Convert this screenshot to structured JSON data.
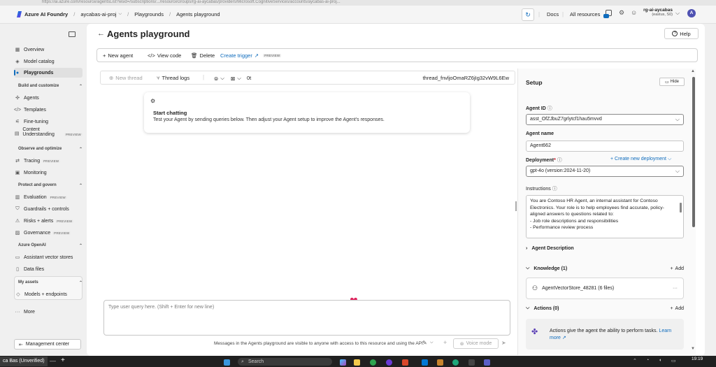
{
  "browser": {
    "url": "https://ai.azure.com/resource/agentsList?wsid=/subscriptions/.../resourceGroups/rg-ai-aycabas/providers/Microsoft.CognitiveServices/accounts/aycabas-ai-proj..."
  },
  "header": {
    "brand": "Azure AI Foundry",
    "project": "aycabas-ai-proj",
    "breadcrumbs": [
      "Playgrounds",
      "Agents playground"
    ],
    "docs": "Docs",
    "all_resources": "All resources",
    "account_name": "rg-ai-aycabas",
    "account_region": "(eastus, S0)",
    "avatar_initial": "A"
  },
  "sidebar": {
    "items_top": [
      "Overview",
      "Model catalog",
      "Playgrounds"
    ],
    "section_build": "Build and customize",
    "items_build": [
      "Agents",
      "Templates",
      "Fine-tuning",
      "Content",
      "Understanding"
    ],
    "section_observe": "Observe and optimize",
    "items_observe": [
      "Tracing",
      "Monitoring"
    ],
    "section_protect": "Protect and govern",
    "items_protect": [
      "Evaluation",
      "Guardrails + controls",
      "Risks + alerts",
      "Governance"
    ],
    "section_openai": "Azure OpenAI",
    "items_openai": [
      "Assistant vector stores",
      "Data files"
    ],
    "section_assets": "My assets",
    "items_assets": [
      "Models + endpoints"
    ],
    "more": "More",
    "management": "Management center",
    "preview": "PREVIEW"
  },
  "page": {
    "title": "Agents playground",
    "help": "Help"
  },
  "toolbar": {
    "new_agent": "New agent",
    "view_code": "View code",
    "delete": "Delete",
    "create_trigger": "Create trigger",
    "preview": "PREVIEW"
  },
  "thread": {
    "new_thread": "New thread",
    "thread_logs": "Thread logs",
    "token_count": "0t",
    "thread_id": "thread_fnvljoOmaRZ6jIg32vW9L6Ew"
  },
  "chat_card": {
    "title": "Start chatting",
    "body": "Test your Agent by sending queries below. Then adjust your Agent setup to improve the Agent's responses."
  },
  "input": {
    "placeholder": "Type user query here. (Shift + Enter for new line)",
    "footer_note": "Messages in the Agents playground are visible to anyone with access to this resource and using the API.",
    "voice_mode": "Voice mode"
  },
  "setup": {
    "title": "Setup",
    "hide": "Hide",
    "agent_id_label": "Agent ID",
    "agent_id": "asst_OfZJbuZ7grlytcf1hau5mvvd",
    "agent_name_label": "Agent name",
    "agent_name": "Agent662",
    "deployment_label": "Deployment",
    "create_deployment": "Create new deployment",
    "deployment": "gpt-4o (version:2024-11-20)",
    "instructions_label": "Instructions",
    "instructions": [
      "You are Contoso HR Agent, an internal assistant for Contoso",
      "Electronics. Your role is to help employees find accurate, policy-",
      "aligned answers to questions related to:",
      "- Job role descriptions and responsibilities",
      "- Performance review process"
    ],
    "agent_description": "Agent Description",
    "knowledge": "Knowledge (1)",
    "add": "Add",
    "vector_store": "AgentVectorStore_48281 (6 files)",
    "actions": "Actions (0)",
    "actions_info": "Actions give the agent the ability to perform tasks.",
    "learn_more": "Learn more"
  },
  "taskbar": {
    "user": "ca Bas (Unverified)",
    "search": "Search",
    "time": "19:19"
  }
}
